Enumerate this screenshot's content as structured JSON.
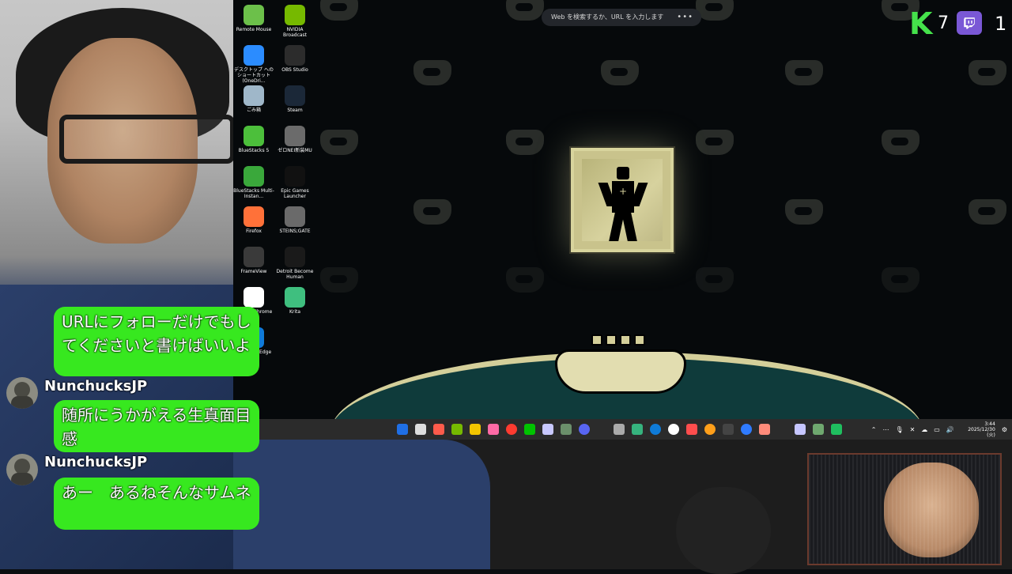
{
  "desktop": {
    "search": {
      "placeholder": "Web を検索するか、URL を入力します",
      "menu_icon": "ellipsis-icon"
    },
    "icons": [
      {
        "label": "Remote Mouse",
        "icon": "remote-mouse-icon",
        "color": "#6cc04a"
      },
      {
        "label": "NVIDIA Broadcast",
        "icon": "nvidia-broadcast-icon",
        "color": "#76b900"
      },
      {
        "label": "デスクトップ へのショートカット (OneDri...",
        "icon": "onedrive-shortcut-icon",
        "color": "#2b8cff"
      },
      {
        "label": "OBS Studio",
        "icon": "obs-icon",
        "color": "#2c2c2c"
      },
      {
        "label": "ごみ箱",
        "icon": "recycle-bin-icon",
        "color": "#9fb7c9"
      },
      {
        "label": "Steam",
        "icon": "steam-icon",
        "color": "#1b2838"
      },
      {
        "label": "BlueStacks 5",
        "icon": "bluestacks-icon",
        "color": "#4cbf3b"
      },
      {
        "label": "ゼロNEI新装MU",
        "icon": "game-shortcut-icon",
        "color": "#6b6b6b"
      },
      {
        "label": "BlueStacks Multi-Instan...",
        "icon": "bluestacks-multi-icon",
        "color": "#3aa83b"
      },
      {
        "label": "Epic Games Launcher",
        "icon": "epic-games-icon",
        "color": "#111111"
      },
      {
        "label": "Firefox",
        "icon": "firefox-icon",
        "color": "#ff7139"
      },
      {
        "label": "STEINS;GATE",
        "icon": "steins-gate-icon",
        "color": "#6a6a6a"
      },
      {
        "label": "FrameView",
        "icon": "frameview-icon",
        "color": "#3a3a3a"
      },
      {
        "label": "Detroit Become Human",
        "icon": "detroit-icon",
        "color": "#1a1a1a"
      },
      {
        "label": "Google Chrome",
        "icon": "chrome-icon",
        "color": "#ffffff"
      },
      {
        "label": "Krita",
        "icon": "krita-icon",
        "color": "#3fbf7f"
      },
      {
        "label": "Microsoft Edge",
        "icon": "edge-icon",
        "color": "#0f7bd7"
      }
    ]
  },
  "overlay": {
    "kick_count": "7",
    "twitch_count": "1",
    "kick_letter": "K",
    "kick_color": "#45e14b",
    "twitch_color": "#7a58d6"
  },
  "taskbar": {
    "time": "3:44",
    "date": "2025/12/30 (火)",
    "system_icons": [
      "chevron-up-icon",
      "network-icon",
      "microphone-icon",
      "close-icon",
      "cloud-icon",
      "battery-icon",
      "volume-icon",
      "settings-icon"
    ]
  },
  "chat": {
    "messages": [
      {
        "user": "",
        "text": "URLにフォローだけでもしてくださいと書けばいいよ"
      },
      {
        "user": "NunchucksJP",
        "text": "随所にうかがえる生真面目感"
      },
      {
        "user": "NunchucksJP",
        "text": "あー　あるねそんなサムネ"
      }
    ],
    "accent_color": "#37e81f"
  }
}
